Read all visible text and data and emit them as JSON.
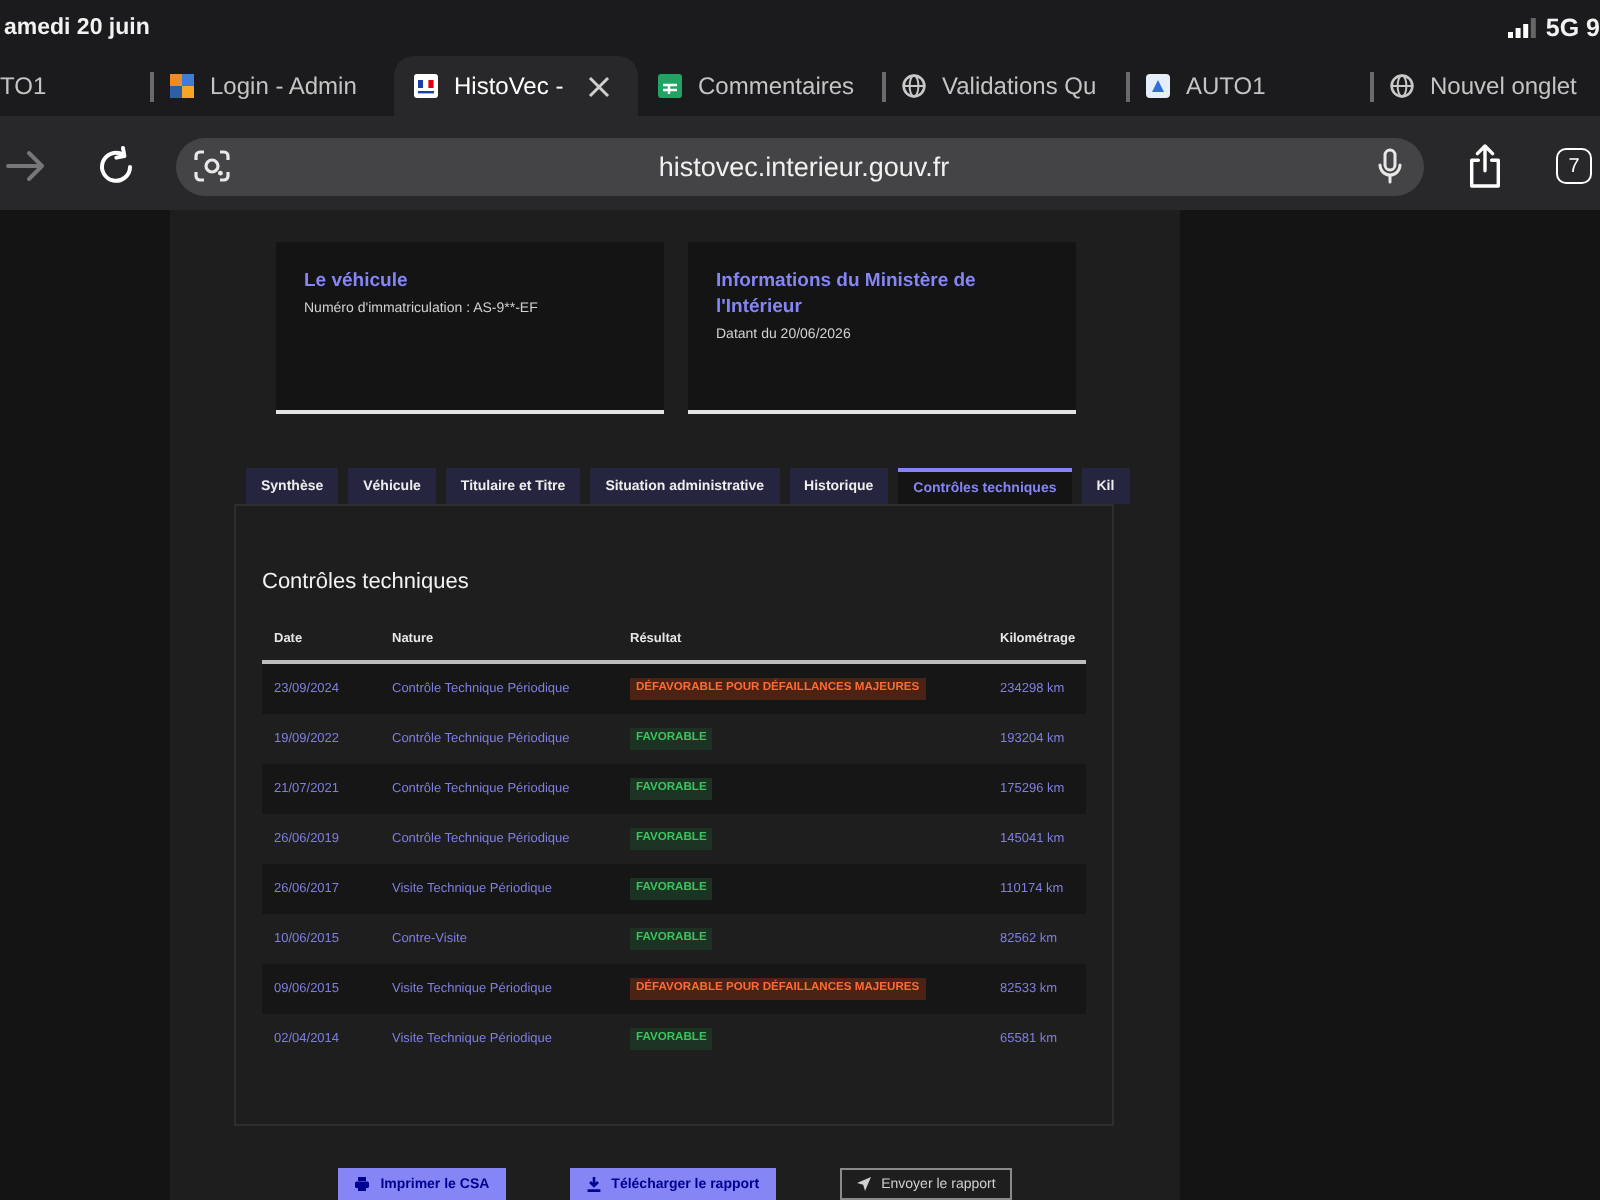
{
  "status_bar": {
    "date": "amedi 20 juin",
    "network": "5G 9"
  },
  "browser_tabs": [
    {
      "title": "TO1",
      "kind": "none",
      "selected": false
    },
    {
      "title": "Login - Admin",
      "kind": "squares",
      "selected": false
    },
    {
      "title": "HistoVec -",
      "kind": "flag",
      "selected": true
    },
    {
      "title": "Commentaires",
      "kind": "sheet",
      "selected": false
    },
    {
      "title": "Validations Qu",
      "kind": "globe",
      "selected": false
    },
    {
      "title": "AUTO1",
      "kind": "app",
      "selected": false
    },
    {
      "title": "Nouvel onglet",
      "kind": "globe",
      "selected": false
    }
  ],
  "toolbar": {
    "forward_button": {
      "disabled": true
    },
    "url": "histovec.interieur.gouv.fr",
    "tab_count": "7"
  },
  "cards": [
    {
      "title": "Le véhicule",
      "text": "Numéro d'immatriculation : AS-9**-EF"
    },
    {
      "title": "Informations du Ministère de l'Intérieur",
      "text": "Datant du 20/06/2026"
    }
  ],
  "tabs": [
    {
      "label": "Synthèse",
      "selected": false
    },
    {
      "label": "Véhicule",
      "selected": false
    },
    {
      "label": "Titulaire et Titre",
      "selected": false
    },
    {
      "label": "Situation administrative",
      "selected": false
    },
    {
      "label": "Historique",
      "selected": false
    },
    {
      "label": "Contrôles techniques",
      "selected": true
    },
    {
      "label": "Kil",
      "selected": false
    }
  ],
  "panel": {
    "title": "Contrôles techniques",
    "columns": [
      "Date",
      "Nature",
      "Résultat",
      "Kilométrage"
    ],
    "rows": [
      {
        "date": "23/09/2024",
        "nature": "Contrôle Technique Périodique",
        "result": {
          "text": "DÉFAVORABLE POUR DÉFAILLANCES MAJEURES",
          "kind": "unfavorable"
        },
        "mileage": "234298 km"
      },
      {
        "date": "19/09/2022",
        "nature": "Contrôle Technique Périodique",
        "result": {
          "text": "FAVORABLE",
          "kind": "favorable"
        },
        "mileage": "193204 km"
      },
      {
        "date": "21/07/2021",
        "nature": "Contrôle Technique Périodique",
        "result": {
          "text": "FAVORABLE",
          "kind": "favorable"
        },
        "mileage": "175296 km"
      },
      {
        "date": "26/06/2019",
        "nature": "Contrôle Technique Périodique",
        "result": {
          "text": "FAVORABLE",
          "kind": "favorable"
        },
        "mileage": "145041 km"
      },
      {
        "date": "26/06/2017",
        "nature": "Visite Technique Périodique",
        "result": {
          "text": "FAVORABLE",
          "kind": "favorable"
        },
        "mileage": "110174 km"
      },
      {
        "date": "10/06/2015",
        "nature": "Contre-Visite",
        "result": {
          "text": "FAVORABLE",
          "kind": "favorable"
        },
        "mileage": "82562 km"
      },
      {
        "date": "09/06/2015",
        "nature": "Visite Technique Périodique",
        "result": {
          "text": "DÉFAVORABLE POUR DÉFAILLANCES MAJEURES",
          "kind": "unfavorable"
        },
        "mileage": "82533 km"
      },
      {
        "date": "02/04/2014",
        "nature": "Visite Technique Périodique",
        "result": {
          "text": "FAVORABLE",
          "kind": "favorable"
        },
        "mileage": "65581 km"
      }
    ]
  },
  "buttons": [
    {
      "label": "Imprimer le CSA",
      "kind": "print"
    },
    {
      "label": "Télécharger le rapport",
      "kind": "download"
    },
    {
      "label": "Envoyer le rapport",
      "kind": "send"
    }
  ]
}
